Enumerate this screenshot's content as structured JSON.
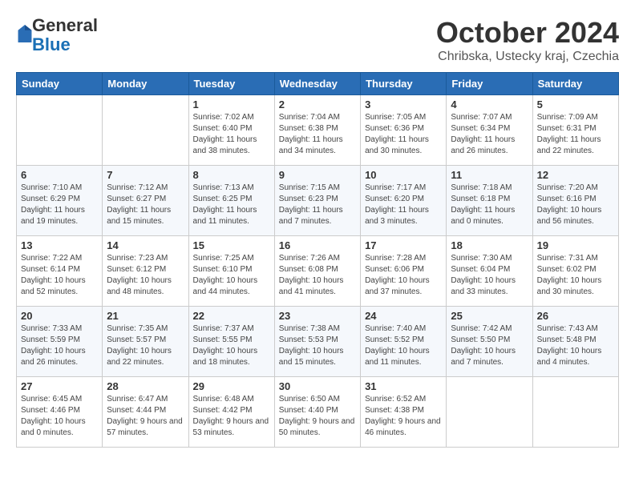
{
  "header": {
    "logo_general": "General",
    "logo_blue": "Blue",
    "month_title": "October 2024",
    "location": "Chribska, Ustecky kraj, Czechia"
  },
  "days_of_week": [
    "Sunday",
    "Monday",
    "Tuesday",
    "Wednesday",
    "Thursday",
    "Friday",
    "Saturday"
  ],
  "weeks": [
    [
      {
        "day": "",
        "info": ""
      },
      {
        "day": "",
        "info": ""
      },
      {
        "day": "1",
        "info": "Sunrise: 7:02 AM\nSunset: 6:40 PM\nDaylight: 11 hours and 38 minutes."
      },
      {
        "day": "2",
        "info": "Sunrise: 7:04 AM\nSunset: 6:38 PM\nDaylight: 11 hours and 34 minutes."
      },
      {
        "day": "3",
        "info": "Sunrise: 7:05 AM\nSunset: 6:36 PM\nDaylight: 11 hours and 30 minutes."
      },
      {
        "day": "4",
        "info": "Sunrise: 7:07 AM\nSunset: 6:34 PM\nDaylight: 11 hours and 26 minutes."
      },
      {
        "day": "5",
        "info": "Sunrise: 7:09 AM\nSunset: 6:31 PM\nDaylight: 11 hours and 22 minutes."
      }
    ],
    [
      {
        "day": "6",
        "info": "Sunrise: 7:10 AM\nSunset: 6:29 PM\nDaylight: 11 hours and 19 minutes."
      },
      {
        "day": "7",
        "info": "Sunrise: 7:12 AM\nSunset: 6:27 PM\nDaylight: 11 hours and 15 minutes."
      },
      {
        "day": "8",
        "info": "Sunrise: 7:13 AM\nSunset: 6:25 PM\nDaylight: 11 hours and 11 minutes."
      },
      {
        "day": "9",
        "info": "Sunrise: 7:15 AM\nSunset: 6:23 PM\nDaylight: 11 hours and 7 minutes."
      },
      {
        "day": "10",
        "info": "Sunrise: 7:17 AM\nSunset: 6:20 PM\nDaylight: 11 hours and 3 minutes."
      },
      {
        "day": "11",
        "info": "Sunrise: 7:18 AM\nSunset: 6:18 PM\nDaylight: 11 hours and 0 minutes."
      },
      {
        "day": "12",
        "info": "Sunrise: 7:20 AM\nSunset: 6:16 PM\nDaylight: 10 hours and 56 minutes."
      }
    ],
    [
      {
        "day": "13",
        "info": "Sunrise: 7:22 AM\nSunset: 6:14 PM\nDaylight: 10 hours and 52 minutes."
      },
      {
        "day": "14",
        "info": "Sunrise: 7:23 AM\nSunset: 6:12 PM\nDaylight: 10 hours and 48 minutes."
      },
      {
        "day": "15",
        "info": "Sunrise: 7:25 AM\nSunset: 6:10 PM\nDaylight: 10 hours and 44 minutes."
      },
      {
        "day": "16",
        "info": "Sunrise: 7:26 AM\nSunset: 6:08 PM\nDaylight: 10 hours and 41 minutes."
      },
      {
        "day": "17",
        "info": "Sunrise: 7:28 AM\nSunset: 6:06 PM\nDaylight: 10 hours and 37 minutes."
      },
      {
        "day": "18",
        "info": "Sunrise: 7:30 AM\nSunset: 6:04 PM\nDaylight: 10 hours and 33 minutes."
      },
      {
        "day": "19",
        "info": "Sunrise: 7:31 AM\nSunset: 6:02 PM\nDaylight: 10 hours and 30 minutes."
      }
    ],
    [
      {
        "day": "20",
        "info": "Sunrise: 7:33 AM\nSunset: 5:59 PM\nDaylight: 10 hours and 26 minutes."
      },
      {
        "day": "21",
        "info": "Sunrise: 7:35 AM\nSunset: 5:57 PM\nDaylight: 10 hours and 22 minutes."
      },
      {
        "day": "22",
        "info": "Sunrise: 7:37 AM\nSunset: 5:55 PM\nDaylight: 10 hours and 18 minutes."
      },
      {
        "day": "23",
        "info": "Sunrise: 7:38 AM\nSunset: 5:53 PM\nDaylight: 10 hours and 15 minutes."
      },
      {
        "day": "24",
        "info": "Sunrise: 7:40 AM\nSunset: 5:52 PM\nDaylight: 10 hours and 11 minutes."
      },
      {
        "day": "25",
        "info": "Sunrise: 7:42 AM\nSunset: 5:50 PM\nDaylight: 10 hours and 7 minutes."
      },
      {
        "day": "26",
        "info": "Sunrise: 7:43 AM\nSunset: 5:48 PM\nDaylight: 10 hours and 4 minutes."
      }
    ],
    [
      {
        "day": "27",
        "info": "Sunrise: 6:45 AM\nSunset: 4:46 PM\nDaylight: 10 hours and 0 minutes."
      },
      {
        "day": "28",
        "info": "Sunrise: 6:47 AM\nSunset: 4:44 PM\nDaylight: 9 hours and 57 minutes."
      },
      {
        "day": "29",
        "info": "Sunrise: 6:48 AM\nSunset: 4:42 PM\nDaylight: 9 hours and 53 minutes."
      },
      {
        "day": "30",
        "info": "Sunrise: 6:50 AM\nSunset: 4:40 PM\nDaylight: 9 hours and 50 minutes."
      },
      {
        "day": "31",
        "info": "Sunrise: 6:52 AM\nSunset: 4:38 PM\nDaylight: 9 hours and 46 minutes."
      },
      {
        "day": "",
        "info": ""
      },
      {
        "day": "",
        "info": ""
      }
    ]
  ]
}
